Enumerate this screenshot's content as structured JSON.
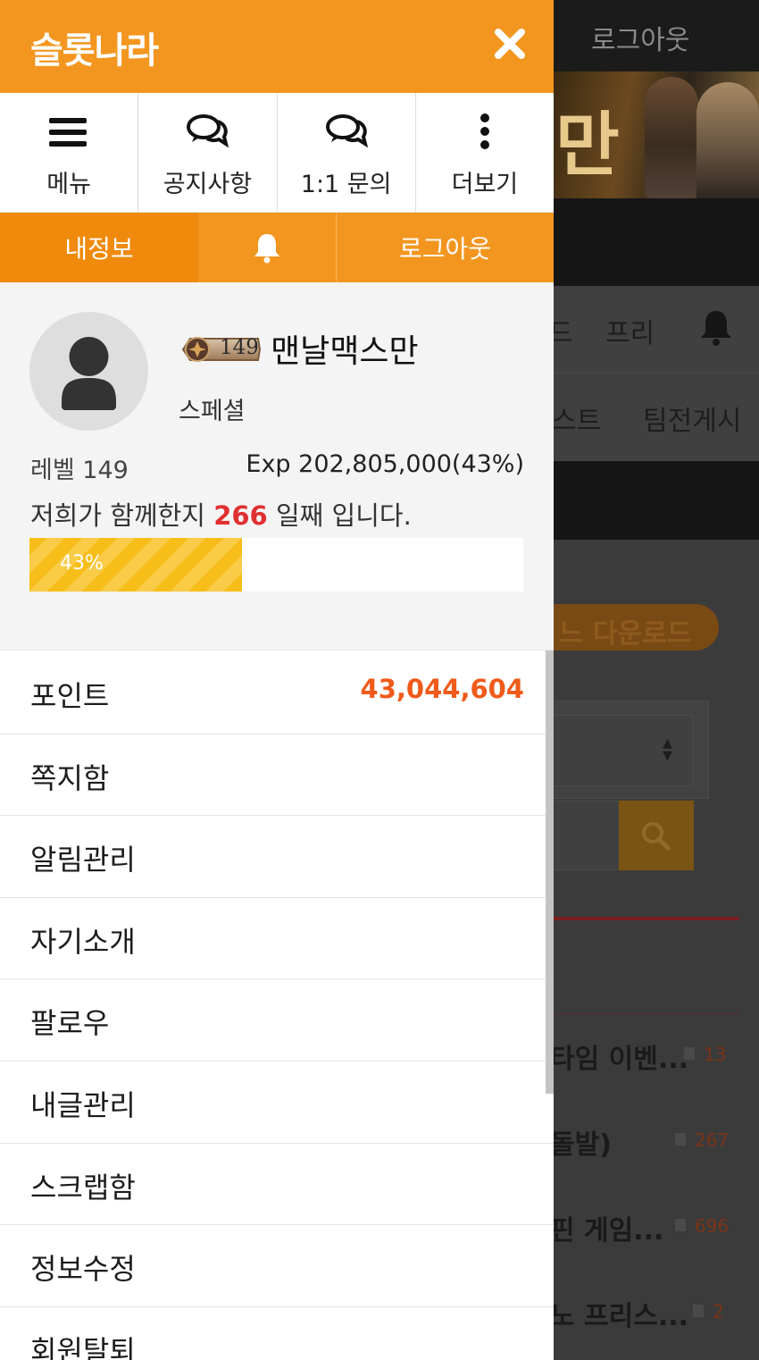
{
  "background": {
    "logout_label": "로그아웃",
    "banner_text": "만",
    "nav1": [
      "드",
      "프리"
    ],
    "nav2": [
      "스트",
      "팀전게시"
    ],
    "download_label": "느 다운로드",
    "rows": [
      {
        "text": "타임 이벤...",
        "count": "13"
      },
      {
        "text": "돌발)",
        "count": "267"
      },
      {
        "text": "핀 게임...",
        "count": "696"
      },
      {
        "text": "노 프리스...",
        "count": "2"
      }
    ]
  },
  "drawer": {
    "title": "슬롯나라",
    "quick_nav": [
      {
        "label": "메뉴",
        "icon": "hamburger-icon"
      },
      {
        "label": "공지사항",
        "icon": "chat-bubbles-icon"
      },
      {
        "label": "1:1 문의",
        "icon": "chat-bubbles-icon"
      },
      {
        "label": "더보기",
        "icon": "vertical-dots-icon"
      }
    ],
    "tabs": {
      "my_info": "내정보",
      "bell_icon": "bell-icon",
      "logout": "로그아웃"
    },
    "profile": {
      "level_badge": "149",
      "nickname": "맨날맥스만",
      "grade": "스페셜",
      "level_text": "레벨 149",
      "exp_text": "Exp 202,805,000(43%)",
      "days_prefix": "저희가 함께한지",
      "days_value": "266",
      "days_suffix": "일째 입니다.",
      "progress_label": "43%",
      "progress_fraction": 0.43
    },
    "menu": [
      {
        "label": "포인트",
        "value": "43,044,604"
      },
      {
        "label": "쪽지함"
      },
      {
        "label": "알림관리"
      },
      {
        "label": "자기소개"
      },
      {
        "label": "팔로우"
      },
      {
        "label": "내글관리"
      },
      {
        "label": "스크랩함"
      },
      {
        "label": "정보수정"
      },
      {
        "label": "회원탈퇴"
      }
    ]
  },
  "colors": {
    "brand_orange": "#f3961f",
    "active_tab": "#f08a0c",
    "points_orange": "#f05a1a",
    "days_red": "#e03030",
    "progress_yellow": "#f7be1a"
  }
}
